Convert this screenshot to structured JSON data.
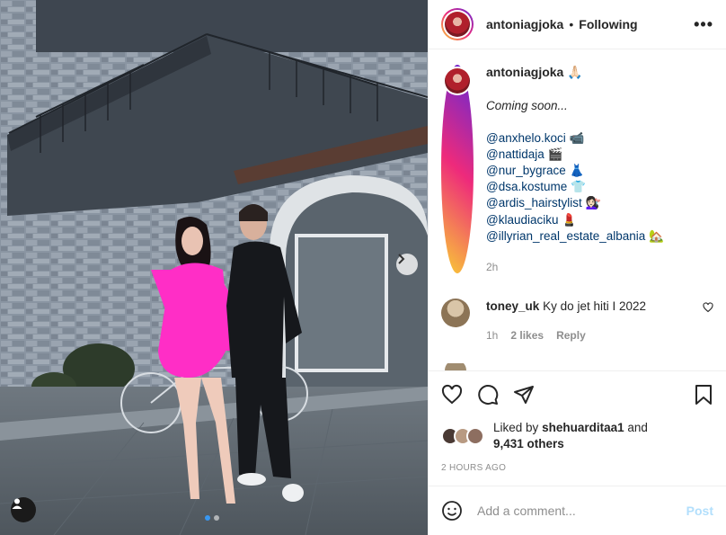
{
  "post": {
    "author": "antoniagjoka",
    "separator": "•",
    "follow_status": "Following",
    "more_icon": "more-horizontal-icon"
  },
  "caption": {
    "author": "antoniagjoka",
    "emoji": "🙏🏻",
    "lines": [
      "Coming soon...",
      "",
      "@anxhelo.koci 📹",
      "@nattidaja 🎬",
      "@nur_bygrace 👗",
      "@dsa.kostume 👕",
      "@ardis_hairstylist 💇🏻‍♀️",
      "@klaudiaciku 💄",
      "@illyrian_real_estate_albania 🏡"
    ],
    "time": "2h"
  },
  "comment": {
    "author": "toney_uk",
    "text": "Ky do jet hiti I 2022",
    "time": "1h",
    "likes": "2 likes",
    "reply": "Reply"
  },
  "likes": {
    "prefix": "Liked by",
    "user": "shehuarditaa1",
    "and": "and",
    "others": "9,431 others"
  },
  "posted": "2 HOURS AGO",
  "add_comment": {
    "placeholder": "Add a comment...",
    "post_label": "Post"
  },
  "colors": {
    "link": "#00376b",
    "muted": "#8e8e8e",
    "post_disabled": "#b2dffc",
    "carousel_active": "#3897f0"
  }
}
